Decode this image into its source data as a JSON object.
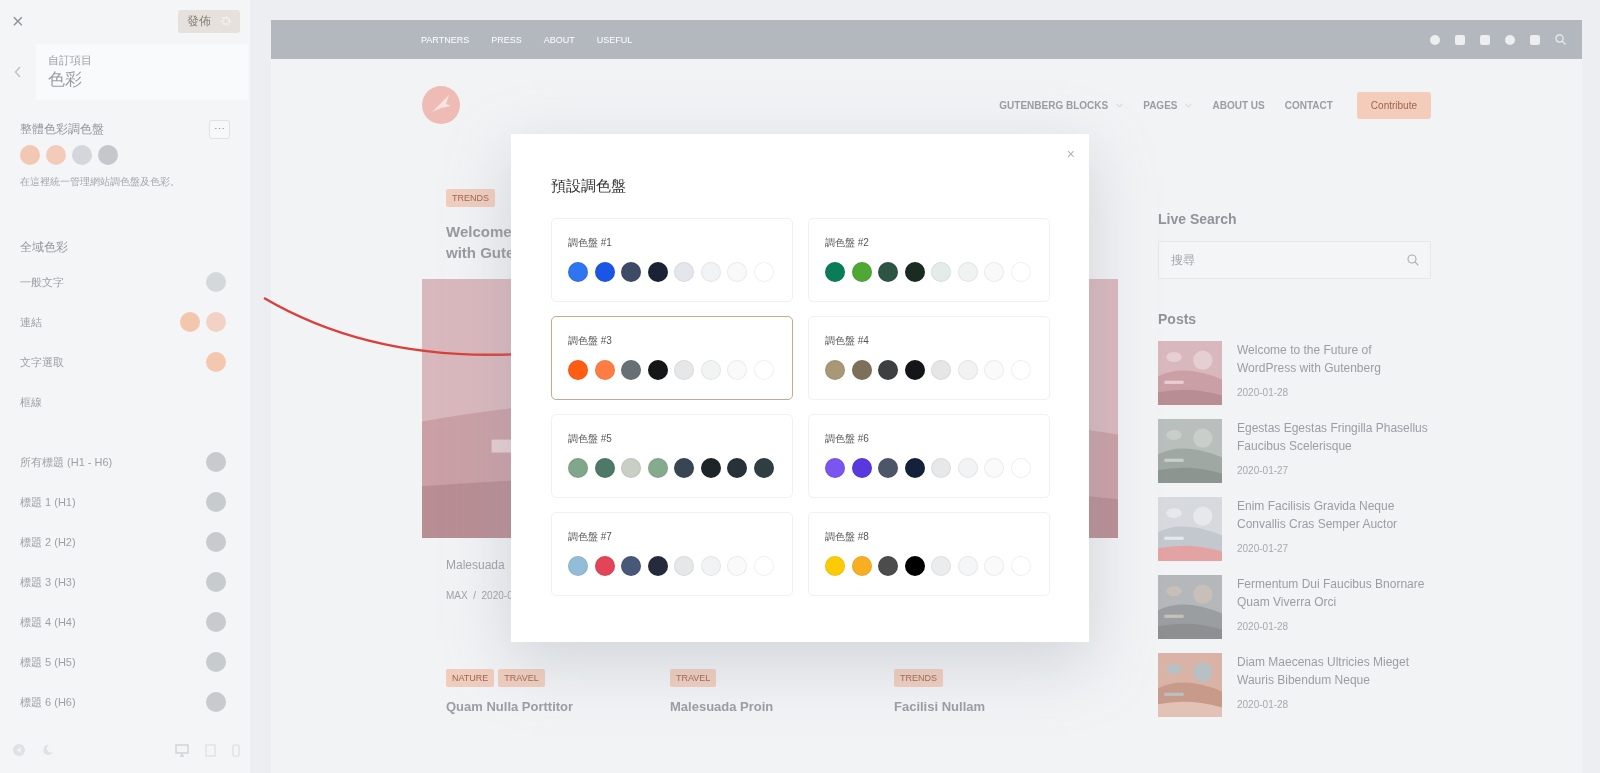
{
  "editor": {
    "close": "×",
    "publish": "發佈",
    "breadcrumb": "自訂項目",
    "section": "色彩",
    "palette_label": "整體色彩調色盤",
    "more": "⋯",
    "swatches": [
      {
        "color": "#f3c8b2"
      },
      {
        "color": "#f3cbb9"
      },
      {
        "color": "#d3d6da"
      },
      {
        "color": "#c4c7cc"
      }
    ],
    "hint": "在這裡統一管理網站調色盤及色彩。",
    "global_title": "全域色彩",
    "rows": [
      {
        "label": "一般文字",
        "swatches": [
          {
            "color": "#d5d8da"
          }
        ]
      },
      {
        "label": "連結",
        "swatches": [
          {
            "color": "#f3c6ae"
          },
          {
            "color": "#f3d2c6"
          }
        ]
      },
      {
        "label": "文字選取",
        "swatches": [
          {
            "color": "#f3c8ae"
          }
        ]
      },
      {
        "label": "框線"
      },
      {
        "label": "所有標題 (H1 - H6)",
        "swatches": [
          {
            "color": "#c8cbcd"
          }
        ]
      },
      {
        "label": "標題 1 (H1)",
        "swatches": [
          {
            "color": "#c8cbcd"
          }
        ]
      },
      {
        "label": "標題 2 (H2)",
        "swatches": [
          {
            "color": "#c8cbcd"
          }
        ]
      },
      {
        "label": "標題 3 (H3)",
        "swatches": [
          {
            "color": "#c8cbcd"
          }
        ]
      },
      {
        "label": "標題 4 (H4)",
        "swatches": [
          {
            "color": "#c8cbcd"
          }
        ]
      },
      {
        "label": "標題 5 (H5)",
        "swatches": [
          {
            "color": "#c8cbcd"
          }
        ]
      },
      {
        "label": "標題 6 (H6)",
        "swatches": [
          {
            "color": "#c8cbcd"
          }
        ]
      }
    ]
  },
  "site": {
    "topbar_links": [
      "PARTNERS",
      "PRESS",
      "ABOUT",
      "USEFUL"
    ],
    "nav": [
      {
        "label": "GUTENBERG BLOCKS",
        "dropdown": true
      },
      {
        "label": "PAGES",
        "dropdown": true
      },
      {
        "label": "ABOUT US",
        "dropdown": false
      },
      {
        "label": "CONTACT",
        "dropdown": false
      }
    ],
    "cta": "Contribute",
    "featured": {
      "tag": "TRENDS",
      "title": "Welcome\nwith Gute",
      "excerpt": "Malesuada",
      "meta": "MAX  /  2020-0"
    },
    "posts": [
      {
        "tags": [
          "NATURE",
          "TRAVEL"
        ],
        "title": "Quam Nulla Porttitor"
      },
      {
        "tags": [
          "TRAVEL"
        ],
        "title": "Malesuada Proin"
      },
      {
        "tags": [
          "TRENDS"
        ],
        "title": "Facilisi Nullam"
      }
    ],
    "sidebar": {
      "search_title": "Live Search",
      "search_placeholder": "搜尋",
      "posts_title": "Posts",
      "posts": [
        {
          "title": "Welcome to the Future of WordPress with Gutenberg",
          "date": "2020-01-28"
        },
        {
          "title": "Egestas Egestas Fringilla Phasellus Faucibus Scelerisque",
          "date": "2020-01-27"
        },
        {
          "title": "Enim Facilisis Gravida Neque Convallis Cras Semper Auctor",
          "date": "2020-01-27"
        },
        {
          "title": "Fermentum Dui Faucibus Bnornare Quam Viverra Orci",
          "date": "2020-01-28"
        },
        {
          "title": "Diam Maecenas Ultricies Mieget Wauris Bibendum Neque",
          "date": "2020-01-28"
        }
      ]
    }
  },
  "modal": {
    "title": "預設調色盤",
    "close": "×",
    "palettes": [
      {
        "name": "調色盤 #1",
        "selected": false,
        "swatches": [
          {
            "color": "#2f74f0"
          },
          {
            "color": "#1a56e6"
          },
          {
            "color": "#3d4b66"
          },
          {
            "color": "#1a2336"
          },
          {
            "color": "#e3e6ea"
          },
          {
            "color": "#f1f3f5"
          },
          {
            "color": "#f8f9fa"
          },
          {
            "color": "#ffffff"
          }
        ]
      },
      {
        "name": "調色盤 #2",
        "selected": false,
        "swatches": [
          {
            "color": "#0a7d58"
          },
          {
            "color": "#4fa833"
          },
          {
            "color": "#2e5446"
          },
          {
            "color": "#1a2b22"
          },
          {
            "color": "#e4ebe8"
          },
          {
            "color": "#f0f3f1"
          },
          {
            "color": "#f8f9f8"
          },
          {
            "color": "#ffffff"
          }
        ]
      },
      {
        "name": "調色盤 #3",
        "selected": true,
        "swatches": [
          {
            "color": "#ff5c14"
          },
          {
            "color": "#ff7d45"
          },
          {
            "color": "#667075"
          },
          {
            "color": "#141618"
          },
          {
            "color": "#e6e7e8"
          },
          {
            "color": "#f2f3f3"
          },
          {
            "color": "#fafafa"
          },
          {
            "color": "#ffffff"
          }
        ]
      },
      {
        "name": "調色盤 #4",
        "selected": false,
        "swatches": [
          {
            "color": "#a89878"
          },
          {
            "color": "#7d705a"
          },
          {
            "color": "#3e3f40"
          },
          {
            "color": "#141518"
          },
          {
            "color": "#e6e6e7"
          },
          {
            "color": "#f2f2f2"
          },
          {
            "color": "#fafafa"
          },
          {
            "color": "#ffffff"
          }
        ]
      },
      {
        "name": "調色盤 #5",
        "selected": false,
        "swatches": [
          {
            "color": "#82a68c"
          },
          {
            "color": "#4d7a68"
          },
          {
            "color": "#c8d0c6"
          },
          {
            "color": "#86ab8c"
          },
          {
            "color": "#374652"
          },
          {
            "color": "#1e2529"
          },
          {
            "color": "#27313a"
          },
          {
            "color": "#2e3e42"
          }
        ]
      },
      {
        "name": "調色盤 #6",
        "selected": false,
        "swatches": [
          {
            "color": "#7a55ef"
          },
          {
            "color": "#5a38e0"
          },
          {
            "color": "#4d5668"
          },
          {
            "color": "#14213a"
          },
          {
            "color": "#e6e8ea"
          },
          {
            "color": "#f2f3f4"
          },
          {
            "color": "#fafafa"
          },
          {
            "color": "#ffffff"
          }
        ]
      },
      {
        "name": "調色盤 #7",
        "selected": false,
        "swatches": [
          {
            "color": "#93bcd8"
          },
          {
            "color": "#e34457"
          },
          {
            "color": "#485878"
          },
          {
            "color": "#252b3c"
          },
          {
            "color": "#e6e7e9"
          },
          {
            "color": "#f2f3f4"
          },
          {
            "color": "#fafafa"
          },
          {
            "color": "#ffffff"
          }
        ]
      },
      {
        "name": "調色盤 #8",
        "selected": false,
        "swatches": [
          {
            "color": "#fccb06"
          },
          {
            "color": "#f9ae22"
          },
          {
            "color": "#4c4c4c"
          },
          {
            "color": "#000000"
          },
          {
            "color": "#ebecee"
          },
          {
            "color": "#f5f6f7"
          },
          {
            "color": "#fafafa"
          },
          {
            "color": "#ffffff"
          }
        ]
      }
    ]
  }
}
